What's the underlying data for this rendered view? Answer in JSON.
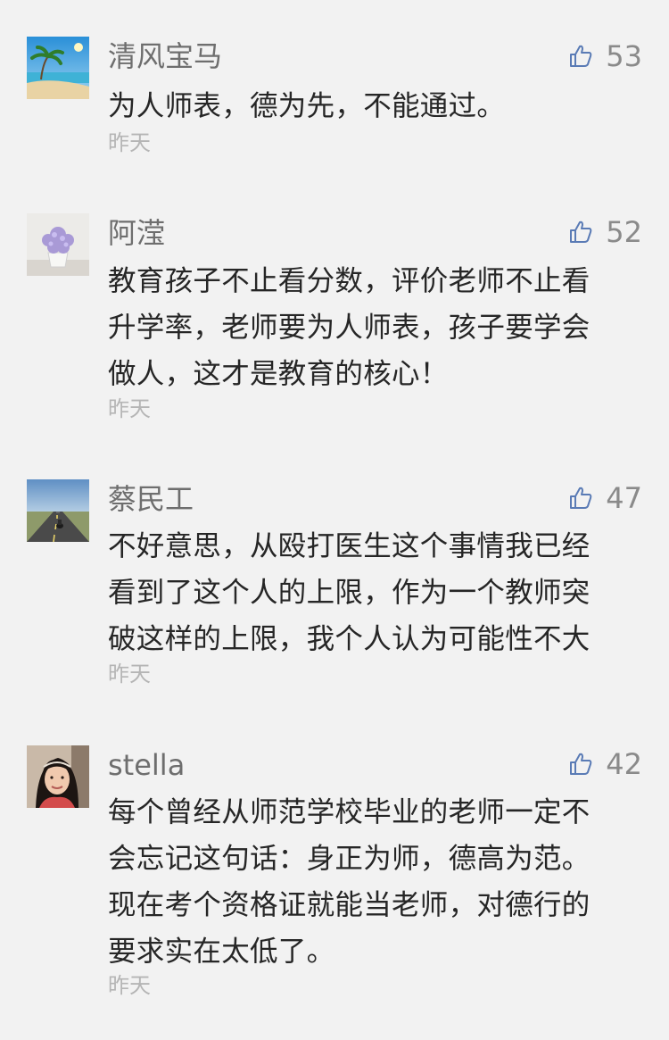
{
  "comments": [
    {
      "avatar": "beach-avatar",
      "username": "清风宝马",
      "likes": "53",
      "lines": [
        "为人师表，德为先，不能通过。"
      ],
      "time": "昨天"
    },
    {
      "avatar": "flower-avatar",
      "username": "阿滢",
      "likes": "52",
      "lines": [
        "教育孩子不止看分数，评价老师不止看",
        "升学率，老师要为人师表，孩子要学会",
        "做人，这才是教育的核心！"
      ],
      "time": "昨天"
    },
    {
      "avatar": "road-avatar",
      "username": "蔡民工",
      "likes": "47",
      "lines": [
        "不好意思，从殴打医生这个事情我已经",
        "看到了这个人的上限，作为一个教师突",
        "破这样的上限，我个人认为可能性不大"
      ],
      "time": "昨天"
    },
    {
      "avatar": "girl-avatar",
      "username": "stella",
      "likes": "42",
      "lines": [
        "每个曾经从师范学校毕业的老师一定不",
        "会忘记这句话：身正为师，德高为范。",
        "现在考个资格证就能当老师，对德行的",
        "要求实在太低了。"
      ],
      "time": "昨天"
    }
  ],
  "colors": {
    "background": "#f2f2f2",
    "username": "#6e6e6e",
    "body": "#262626",
    "time": "#b5b5b5",
    "like": "#8a8a8a"
  }
}
